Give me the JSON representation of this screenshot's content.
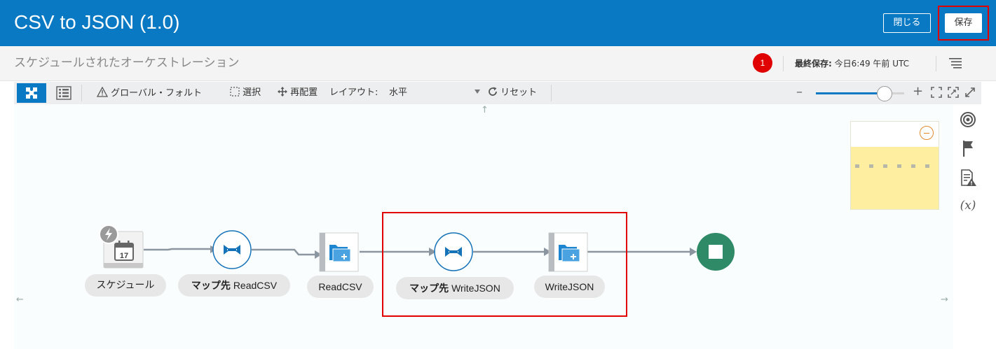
{
  "header": {
    "title": "CSV to JSON (1.0)",
    "close_label": "閉じる",
    "save_label": "保存"
  },
  "subheader": {
    "subtitle": "スケジュールされたオーケストレーション",
    "notification_count": "1",
    "last_saved_label": "最終保存:",
    "last_saved_value": "今日6:49 午前 UTC"
  },
  "toolbar": {
    "global_fault": "グローバル・フォルト",
    "select": "選択",
    "rearrange": "再配置",
    "layout_label": "レイアウト:",
    "layout_value": "水平",
    "reset": "リセット",
    "zoom_level": 0.78
  },
  "canvas": {
    "nodes": [
      {
        "id": "schedule",
        "label": "スケジュール",
        "icon": "calendar-icon",
        "calendar_day": "17"
      },
      {
        "id": "map-readcsv",
        "label_bold": "マップ先",
        "label": "ReadCSV",
        "icon": "map-icon"
      },
      {
        "id": "readcsv",
        "label": "ReadCSV",
        "icon": "file-adapter-icon"
      },
      {
        "id": "map-writejson",
        "label_bold": "マップ先",
        "label": "WriteJSON",
        "icon": "map-icon"
      },
      {
        "id": "writejson",
        "label": "WriteJSON",
        "icon": "file-adapter-icon"
      },
      {
        "id": "end",
        "label": "",
        "icon": "stop-icon"
      }
    ]
  },
  "colors": {
    "header": "#0a79c4",
    "accent": "#0a79c4",
    "highlight": "#e00000",
    "end_node": "#2f8a68",
    "minimap": "#fdeea0"
  }
}
